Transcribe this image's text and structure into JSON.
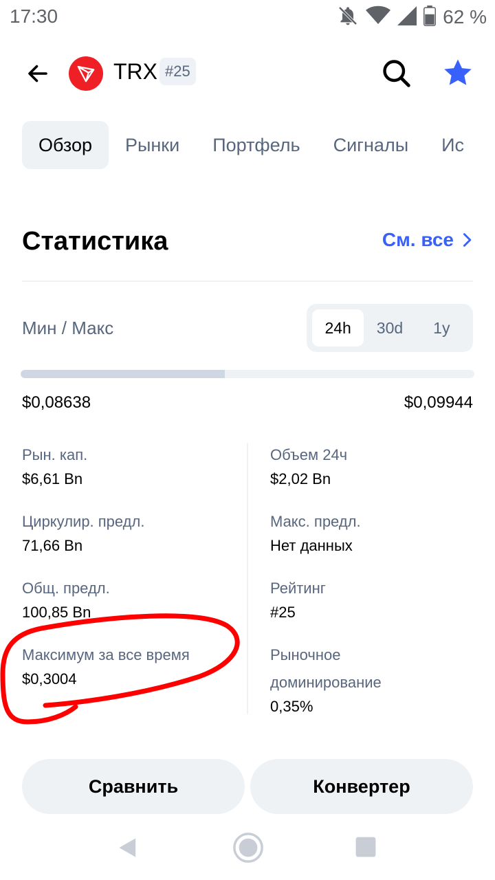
{
  "status_bar": {
    "time": "17:30",
    "battery_text": "62 %",
    "icons": [
      "bell-off-icon",
      "wifi-icon",
      "signal-icon",
      "battery-icon"
    ]
  },
  "header": {
    "coin_symbol": "TRX",
    "rank_badge": "#25",
    "icons": [
      "back-arrow-icon",
      "tron-logo-icon",
      "search-icon",
      "star-icon"
    ],
    "star_color": "#3861fb",
    "logo_color": "#ef1f26"
  },
  "tabs": [
    {
      "label": "Обзор",
      "active": true
    },
    {
      "label": "Рынки",
      "active": false
    },
    {
      "label": "Портфель",
      "active": false
    },
    {
      "label": "Сигналы",
      "active": false
    },
    {
      "label": "Ис",
      "active": false
    }
  ],
  "statistics": {
    "title": "Статистика",
    "see_all": "См. все",
    "range_label": "Мин / Макс",
    "periods": [
      {
        "label": "24h",
        "active": true
      },
      {
        "label": "30d",
        "active": false
      },
      {
        "label": "1y",
        "active": false
      }
    ],
    "range_progress_fraction": 0.45,
    "range_low": "$0,08638",
    "range_high": "$0,09944",
    "left_column": [
      {
        "label": "Рын. кап.",
        "value": "$6,61 Bn"
      },
      {
        "label": "Циркулир. предл.",
        "value": "71,66 Bn"
      },
      {
        "label": "Общ. предл.",
        "value": "100,85 Bn"
      },
      {
        "label": "Максимум за все время",
        "value": "$0,3004"
      }
    ],
    "right_column": [
      {
        "label": "Объем 24ч",
        "value": "$2,02 Bn"
      },
      {
        "label": "Макс. предл.",
        "value": "Нет данных"
      },
      {
        "label": "Рейтинг",
        "value": "#25"
      },
      {
        "label": "Рыночное доминирование",
        "value": "0,35%"
      }
    ]
  },
  "actions": {
    "compare": "Сравнить",
    "convert": "Конвертер"
  },
  "colors": {
    "accent": "#3861fb",
    "muted_text": "#58667e",
    "surface": "#eff2f5",
    "annotation": "#ff0000"
  }
}
